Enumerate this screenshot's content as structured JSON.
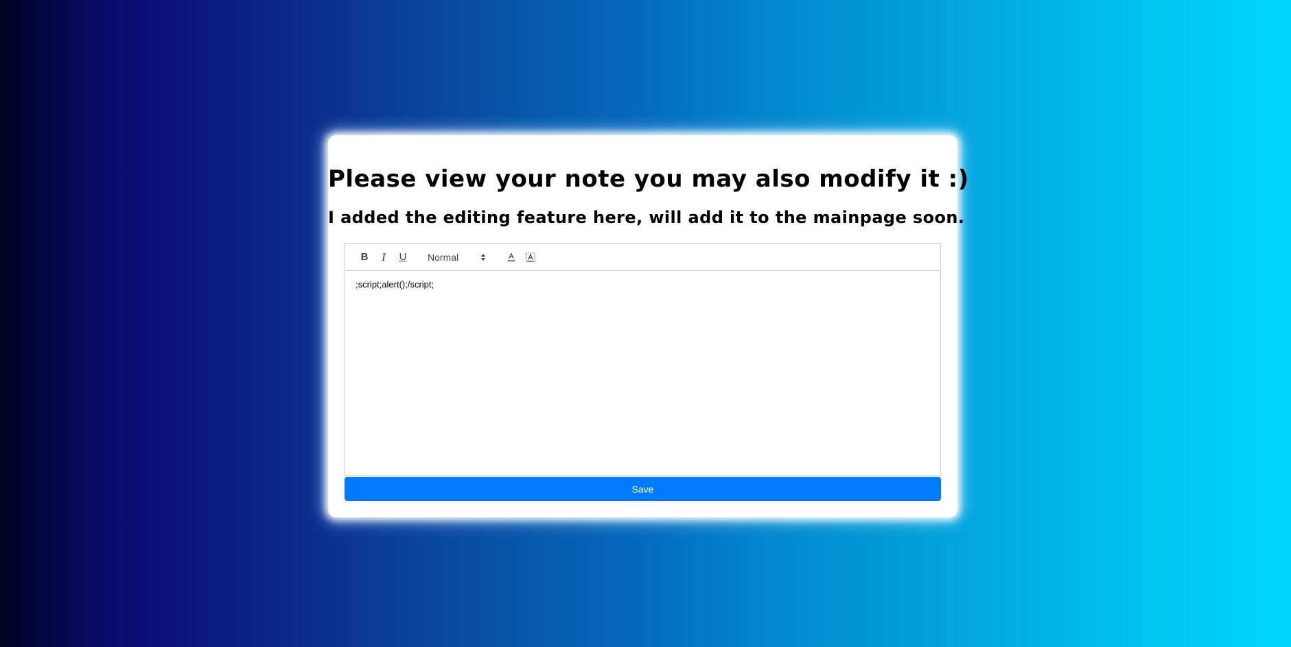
{
  "page": {
    "title": "Please view your note you may also modify it :)",
    "subtitle": "I added the editing feature here, will add it to the mainpage soon."
  },
  "editor": {
    "toolbar": {
      "bold_label": "B",
      "italic_label": "I",
      "underline_label": "U",
      "header_picker_value": "Normal",
      "icons": [
        "bold-icon",
        "italic-icon",
        "underline-icon",
        "text-color-icon",
        "background-color-icon"
      ]
    },
    "content": ";script;alert();/script;"
  },
  "save_button": {
    "label": "Save"
  },
  "colors": {
    "save_button_bg": "#007bff",
    "card_bg": "#ffffff",
    "gradient_start": "#02021f",
    "gradient_end": "#00d6ff"
  }
}
